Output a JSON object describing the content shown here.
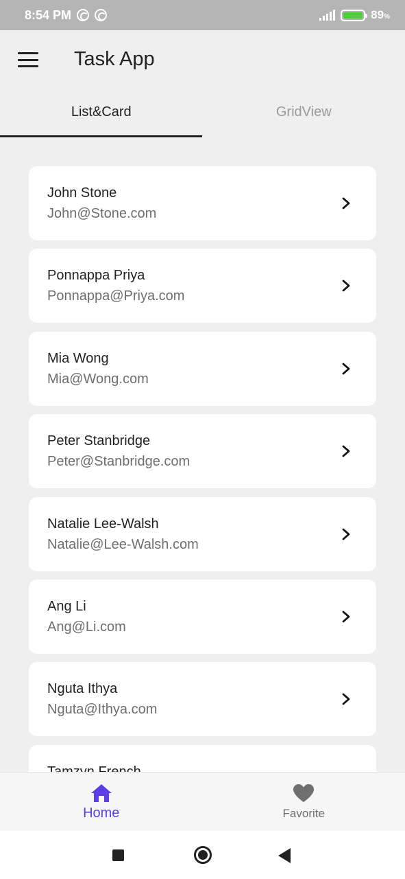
{
  "status_bar": {
    "time": "8:54 PM",
    "battery": "89",
    "battery_unit": "%"
  },
  "app_bar": {
    "title": "Task App"
  },
  "tabs": [
    {
      "label": "List&Card"
    },
    {
      "label": "GridView"
    }
  ],
  "contacts": [
    {
      "name": "John Stone",
      "email": "John@Stone.com"
    },
    {
      "name": "Ponnappa Priya",
      "email": "Ponnappa@Priya.com"
    },
    {
      "name": "Mia Wong",
      "email": "Mia@Wong.com"
    },
    {
      "name": "Peter Stanbridge",
      "email": "Peter@Stanbridge.com"
    },
    {
      "name": "Natalie Lee-Walsh",
      "email": "Natalie@Lee-Walsh.com"
    },
    {
      "name": "Ang Li",
      "email": "Ang@Li.com"
    },
    {
      "name": "Nguta Ithya",
      "email": "Nguta@Ithya.com"
    },
    {
      "name": "Tamzyn French",
      "email": ""
    }
  ],
  "bottom_nav": [
    {
      "label": "Home",
      "icon": "home-icon"
    },
    {
      "label": "Favorite",
      "icon": "heart-icon"
    }
  ],
  "colors": {
    "accent": "#5b3ee6",
    "background": "#efefef",
    "card": "#ffffff"
  }
}
